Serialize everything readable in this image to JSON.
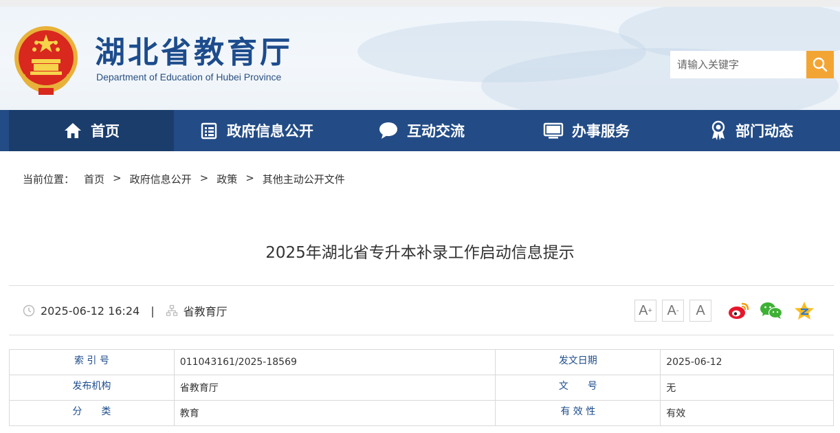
{
  "header": {
    "title": "湖北省教育厅",
    "subtitle": "Department of Education of Hubei Province",
    "search_placeholder": "请输入关键字"
  },
  "nav": [
    {
      "label": "首页",
      "icon": "home-icon",
      "active": true
    },
    {
      "label": "政府信息公开",
      "icon": "document-icon",
      "active": false
    },
    {
      "label": "互动交流",
      "icon": "chat-bubble-icon",
      "active": false
    },
    {
      "label": "办事服务",
      "icon": "monitor-icon",
      "active": false
    },
    {
      "label": "部门动态",
      "icon": "badge-icon",
      "active": false
    }
  ],
  "breadcrumb": {
    "label": "当前位置：",
    "items": [
      "首页",
      "政府信息公开",
      "政策",
      "其他主动公开文件"
    ],
    "separator": ">"
  },
  "article": {
    "title": "2025年湖北省专升本补录工作启动信息提示",
    "datetime": "2025-06-12 16:24",
    "divider": "|",
    "source": "省教育厅"
  },
  "font_controls": {
    "increase": "A",
    "increase_mark": "+",
    "decrease": "A",
    "decrease_mark": "-",
    "reset": "A"
  },
  "share_icons": [
    "weibo-icon",
    "wechat-icon",
    "qzone-icon"
  ],
  "info_table": [
    {
      "k1": "索 引 号",
      "v1": "011043161/2025-18569",
      "k2": "发文日期",
      "v2": "2025-06-12"
    },
    {
      "k1": "发布机构",
      "v1": "省教育厅",
      "k2": "文　　号",
      "v2": "无"
    },
    {
      "k1": "分　　类",
      "v1": "教育",
      "k2": "有 效 性",
      "v2": "有效"
    }
  ],
  "colors": {
    "nav_bg": "#234c86",
    "nav_active": "#1a3d6c",
    "title_blue": "#1d4c8c",
    "search_button": "#f3a534"
  }
}
